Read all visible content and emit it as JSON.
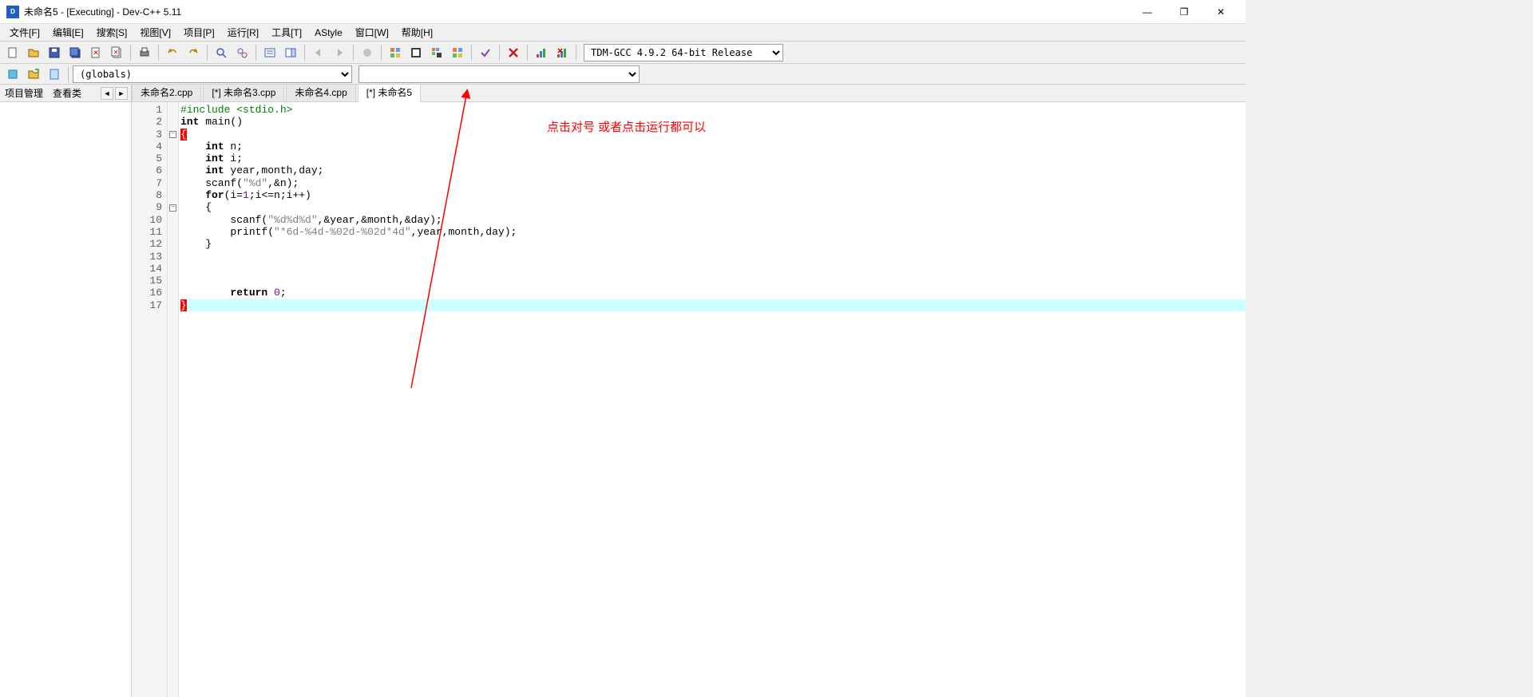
{
  "title": "未命名5 - [Executing] - Dev-C++ 5.11",
  "window_controls": {
    "min": "—",
    "max": "❐",
    "close": "✕"
  },
  "menu": [
    "文件[F]",
    "编辑[E]",
    "搜索[S]",
    "视图[V]",
    "项目[P]",
    "运行[R]",
    "工具[T]",
    "AStyle",
    "窗口[W]",
    "帮助[H]"
  ],
  "compiler_selection": "TDM-GCC 4.9.2 64-bit Release",
  "scope_combo": "(globals)",
  "member_combo": "",
  "sidebar": {
    "tabs": [
      "项目管理",
      "查看类"
    ]
  },
  "editor_tabs": [
    {
      "label": "未命名2.cpp",
      "active": false
    },
    {
      "label": "[*] 未命名3.cpp",
      "active": false
    },
    {
      "label": "未命名4.cpp",
      "active": false
    },
    {
      "label": "[*] 未命名5",
      "active": true
    }
  ],
  "code": {
    "lines": [
      {
        "n": 1,
        "fold": "",
        "html": "<span class='pp'>#include &lt;stdio.h&gt;</span>"
      },
      {
        "n": 2,
        "fold": "",
        "html": "<span class='kw'>int</span> main<span>()</span>"
      },
      {
        "n": 3,
        "fold": "box",
        "html": "<span class='brace-red'>{</span>"
      },
      {
        "n": 4,
        "fold": "",
        "html": "    <span class='kw'>int</span> n;"
      },
      {
        "n": 5,
        "fold": "",
        "html": "    <span class='kw'>int</span> i;"
      },
      {
        "n": 6,
        "fold": "",
        "html": "    <span class='kw'>int</span> year,month,day;"
      },
      {
        "n": 7,
        "fold": "",
        "html": "    scanf(<span class='str'>\"%d\"</span>,&amp;n);"
      },
      {
        "n": 8,
        "fold": "",
        "html": "    <span class='kw'>for</span>(i=<span class='num'>1</span>;i&lt;=n;i++)"
      },
      {
        "n": 9,
        "fold": "box",
        "html": "    {"
      },
      {
        "n": 10,
        "fold": "",
        "html": "        scanf(<span class='str'>\"%d%d%d\"</span>,&amp;year,&amp;month,&amp;day);"
      },
      {
        "n": 11,
        "fold": "",
        "html": "        printf(<span class='str'>\"*6d-%4d-%02d-%02d*4d\"</span>,year,month,day);"
      },
      {
        "n": 12,
        "fold": "",
        "html": "    }"
      },
      {
        "n": 13,
        "fold": "",
        "html": ""
      },
      {
        "n": 14,
        "fold": "",
        "html": ""
      },
      {
        "n": 15,
        "fold": "",
        "html": ""
      },
      {
        "n": 16,
        "fold": "",
        "html": "        <span class='kw'>return</span> <span class='num'>0</span>;"
      },
      {
        "n": 17,
        "fold": "",
        "html": "<span class='brace-red'>}</span>",
        "hl": true
      }
    ]
  },
  "annotation_text": "点击对号 或者点击运行都可以"
}
